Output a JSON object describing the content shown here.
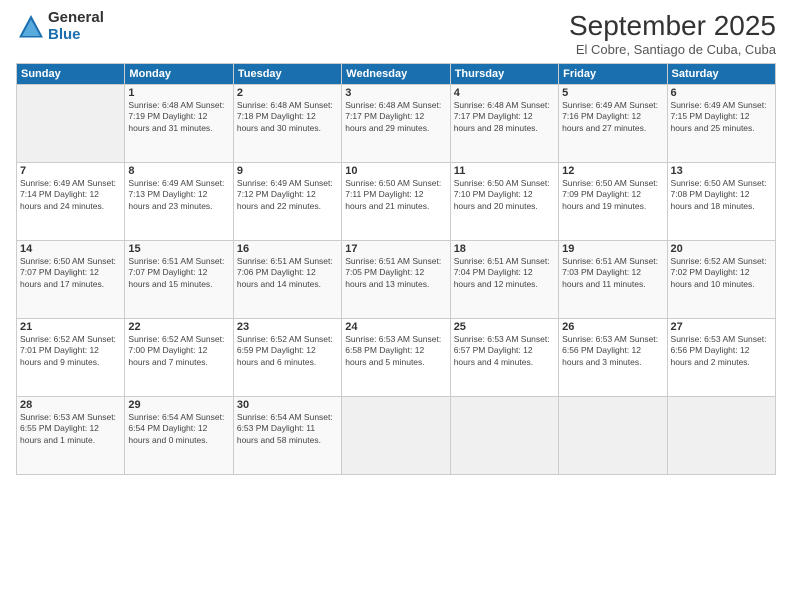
{
  "header": {
    "logo_general": "General",
    "logo_blue": "Blue",
    "month_title": "September 2025",
    "subtitle": "El Cobre, Santiago de Cuba, Cuba"
  },
  "weekdays": [
    "Sunday",
    "Monday",
    "Tuesday",
    "Wednesday",
    "Thursday",
    "Friday",
    "Saturday"
  ],
  "weeks": [
    [
      {
        "day": "",
        "content": ""
      },
      {
        "day": "1",
        "content": "Sunrise: 6:48 AM\nSunset: 7:19 PM\nDaylight: 12 hours\nand 31 minutes."
      },
      {
        "day": "2",
        "content": "Sunrise: 6:48 AM\nSunset: 7:18 PM\nDaylight: 12 hours\nand 30 minutes."
      },
      {
        "day": "3",
        "content": "Sunrise: 6:48 AM\nSunset: 7:17 PM\nDaylight: 12 hours\nand 29 minutes."
      },
      {
        "day": "4",
        "content": "Sunrise: 6:48 AM\nSunset: 7:17 PM\nDaylight: 12 hours\nand 28 minutes."
      },
      {
        "day": "5",
        "content": "Sunrise: 6:49 AM\nSunset: 7:16 PM\nDaylight: 12 hours\nand 27 minutes."
      },
      {
        "day": "6",
        "content": "Sunrise: 6:49 AM\nSunset: 7:15 PM\nDaylight: 12 hours\nand 25 minutes."
      }
    ],
    [
      {
        "day": "7",
        "content": "Sunrise: 6:49 AM\nSunset: 7:14 PM\nDaylight: 12 hours\nand 24 minutes."
      },
      {
        "day": "8",
        "content": "Sunrise: 6:49 AM\nSunset: 7:13 PM\nDaylight: 12 hours\nand 23 minutes."
      },
      {
        "day": "9",
        "content": "Sunrise: 6:49 AM\nSunset: 7:12 PM\nDaylight: 12 hours\nand 22 minutes."
      },
      {
        "day": "10",
        "content": "Sunrise: 6:50 AM\nSunset: 7:11 PM\nDaylight: 12 hours\nand 21 minutes."
      },
      {
        "day": "11",
        "content": "Sunrise: 6:50 AM\nSunset: 7:10 PM\nDaylight: 12 hours\nand 20 minutes."
      },
      {
        "day": "12",
        "content": "Sunrise: 6:50 AM\nSunset: 7:09 PM\nDaylight: 12 hours\nand 19 minutes."
      },
      {
        "day": "13",
        "content": "Sunrise: 6:50 AM\nSunset: 7:08 PM\nDaylight: 12 hours\nand 18 minutes."
      }
    ],
    [
      {
        "day": "14",
        "content": "Sunrise: 6:50 AM\nSunset: 7:07 PM\nDaylight: 12 hours\nand 17 minutes."
      },
      {
        "day": "15",
        "content": "Sunrise: 6:51 AM\nSunset: 7:07 PM\nDaylight: 12 hours\nand 15 minutes."
      },
      {
        "day": "16",
        "content": "Sunrise: 6:51 AM\nSunset: 7:06 PM\nDaylight: 12 hours\nand 14 minutes."
      },
      {
        "day": "17",
        "content": "Sunrise: 6:51 AM\nSunset: 7:05 PM\nDaylight: 12 hours\nand 13 minutes."
      },
      {
        "day": "18",
        "content": "Sunrise: 6:51 AM\nSunset: 7:04 PM\nDaylight: 12 hours\nand 12 minutes."
      },
      {
        "day": "19",
        "content": "Sunrise: 6:51 AM\nSunset: 7:03 PM\nDaylight: 12 hours\nand 11 minutes."
      },
      {
        "day": "20",
        "content": "Sunrise: 6:52 AM\nSunset: 7:02 PM\nDaylight: 12 hours\nand 10 minutes."
      }
    ],
    [
      {
        "day": "21",
        "content": "Sunrise: 6:52 AM\nSunset: 7:01 PM\nDaylight: 12 hours\nand 9 minutes."
      },
      {
        "day": "22",
        "content": "Sunrise: 6:52 AM\nSunset: 7:00 PM\nDaylight: 12 hours\nand 7 minutes."
      },
      {
        "day": "23",
        "content": "Sunrise: 6:52 AM\nSunset: 6:59 PM\nDaylight: 12 hours\nand 6 minutes."
      },
      {
        "day": "24",
        "content": "Sunrise: 6:53 AM\nSunset: 6:58 PM\nDaylight: 12 hours\nand 5 minutes."
      },
      {
        "day": "25",
        "content": "Sunrise: 6:53 AM\nSunset: 6:57 PM\nDaylight: 12 hours\nand 4 minutes."
      },
      {
        "day": "26",
        "content": "Sunrise: 6:53 AM\nSunset: 6:56 PM\nDaylight: 12 hours\nand 3 minutes."
      },
      {
        "day": "27",
        "content": "Sunrise: 6:53 AM\nSunset: 6:56 PM\nDaylight: 12 hours\nand 2 minutes."
      }
    ],
    [
      {
        "day": "28",
        "content": "Sunrise: 6:53 AM\nSunset: 6:55 PM\nDaylight: 12 hours\nand 1 minute."
      },
      {
        "day": "29",
        "content": "Sunrise: 6:54 AM\nSunset: 6:54 PM\nDaylight: 12 hours\nand 0 minutes."
      },
      {
        "day": "30",
        "content": "Sunrise: 6:54 AM\nSunset: 6:53 PM\nDaylight: 11 hours\nand 58 minutes."
      },
      {
        "day": "",
        "content": ""
      },
      {
        "day": "",
        "content": ""
      },
      {
        "day": "",
        "content": ""
      },
      {
        "day": "",
        "content": ""
      }
    ]
  ]
}
